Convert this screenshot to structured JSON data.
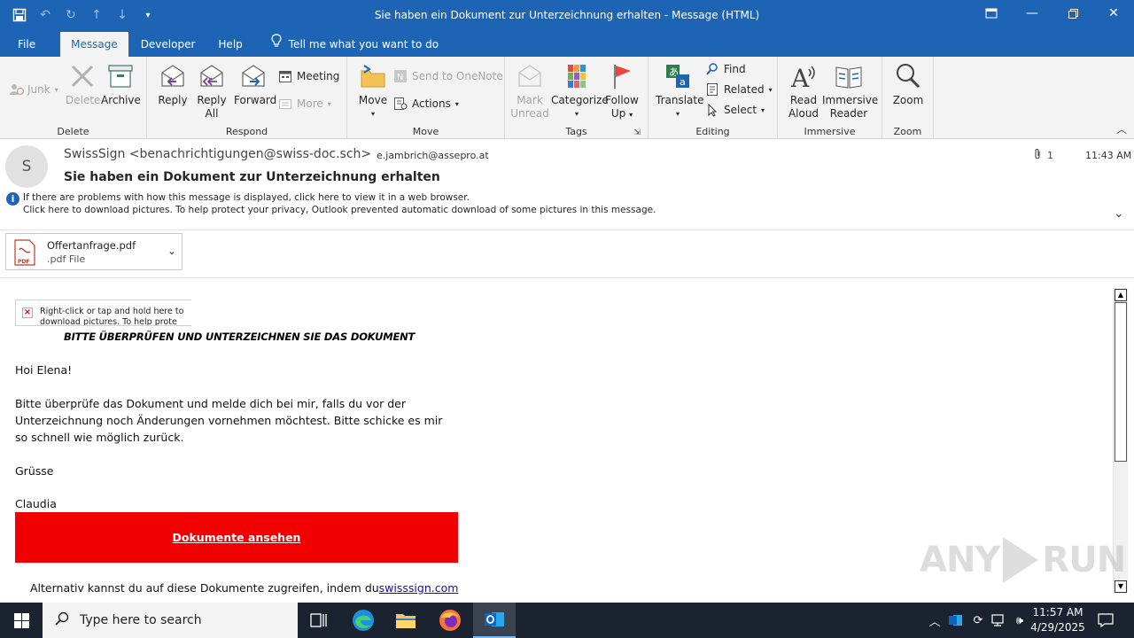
{
  "window": {
    "title": "Sie haben ein Dokument zur Unterzeichnung erhalten  -  Message (HTML)"
  },
  "tabs": [
    "File",
    "Message",
    "Developer",
    "Help"
  ],
  "tell_me": "Tell me what you want to do",
  "ribbon": {
    "delete_group": {
      "label": "Delete",
      "junk": "Junk",
      "delete": "Delete",
      "archive": "Archive"
    },
    "respond_group": {
      "label": "Respond",
      "reply": "Reply",
      "reply_all_1": "Reply",
      "reply_all_2": "All",
      "forward": "Forward",
      "meeting": "Meeting",
      "more": "More"
    },
    "move_group": {
      "label": "Move",
      "move": "Move",
      "onenote": "Send to OneNote",
      "actions": "Actions"
    },
    "tags_group": {
      "label": "Tags",
      "mark_1": "Mark",
      "mark_2": "Unread",
      "categorize": "Categorize",
      "follow_1": "Follow",
      "follow_2": "Up"
    },
    "editing_group": {
      "label": "Editing",
      "translate": "Translate",
      "find": "Find",
      "related": "Related",
      "select": "Select"
    },
    "immersive_group": {
      "label": "Immersive",
      "read_1": "Read",
      "read_2": "Aloud",
      "reader_1": "Immersive",
      "reader_2": "Reader"
    },
    "zoom_group": {
      "label": "Zoom",
      "zoom": "Zoom"
    }
  },
  "message": {
    "avatar_initial": "S",
    "sender": "SwissSign <benachrichtigungen@swiss-doc.sch>",
    "recipient": "e.jambrich@assepro.at",
    "attachment_count": "1",
    "time": "11:43 AM",
    "subject": "Sie haben ein Dokument zur Unterzeichnung erhalten",
    "info_line_1": "If there are problems with how this message is displayed, click here to view it in a web browser.",
    "info_line_2": "Click here to download pictures. To help protect your privacy, Outlook prevented automatic download of some pictures in this message."
  },
  "attachment": {
    "name": "Offertanfrage.pdf",
    "type": ".pdf File",
    "icon_text": "PDF"
  },
  "body": {
    "broken_image_text": "Right-click or tap and hold here to download pictures. To help prote",
    "heading": "BITTE ÜBERPRÜFEN UND UNTERZEICHNEN SIE DAS DOKUMENT",
    "greeting": "Hoi Elena!",
    "paragraph": "Bitte überprüfe das Dokument und melde dich bei mir, falls du vor der Unterzeichnung noch Änderungen vornehmen möchtest. Bitte schicke es mir so schnell wie möglich zurück.",
    "closing": "Grüsse",
    "signature": "Claudia",
    "cta": "Dokumente ansehen",
    "alt_prefix": "Alternativ kannst du auf diese Dokumente zugreifen, indem du",
    "alt_link": "swisssign.com"
  },
  "watermark": {
    "left": "ANY",
    "right": "RUN"
  },
  "taskbar": {
    "search_placeholder": "Type here to search",
    "time": "11:57 AM",
    "date": "4/29/2025"
  },
  "colors": {
    "brand": "#1e64b4",
    "cta": "#f00000"
  }
}
